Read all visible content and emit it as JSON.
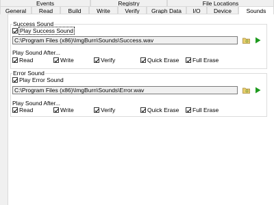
{
  "tabs_top": [
    "Events",
    "Registry",
    "File Locations"
  ],
  "tabs_mid": [
    "General",
    "Read",
    "Build",
    "Write",
    "Verify",
    "Graph Data",
    "I/O",
    "Device",
    "Sounds"
  ],
  "success": {
    "group_title": "Success Sound",
    "play_label": "Play Success Sound",
    "play_checked": true,
    "path": "C:\\Program Files (x86)\\ImgBurn\\Sounds\\Success.wav",
    "after_label": "Play Sound After...",
    "options": [
      {
        "label": "Read",
        "checked": true
      },
      {
        "label": "Write",
        "checked": true
      },
      {
        "label": "Verify",
        "checked": true
      },
      {
        "label": "Quick Erase",
        "checked": true
      },
      {
        "label": "Full Erase",
        "checked": true
      }
    ]
  },
  "error": {
    "group_title": "Error Sound",
    "play_label": "Play Error Sound",
    "play_checked": true,
    "path": "C:\\Program Files (x86)\\ImgBurn\\Sounds\\Error.wav",
    "after_label": "Play Sound After...",
    "options": [
      {
        "label": "Read",
        "checked": true
      },
      {
        "label": "Write",
        "checked": true
      },
      {
        "label": "Verify",
        "checked": true
      },
      {
        "label": "Quick Erase",
        "checked": true
      },
      {
        "label": "Full Erase",
        "checked": true
      }
    ]
  },
  "colors": {
    "play_icon": "#1e9a1e",
    "folder_icon": "#d9b84a"
  }
}
